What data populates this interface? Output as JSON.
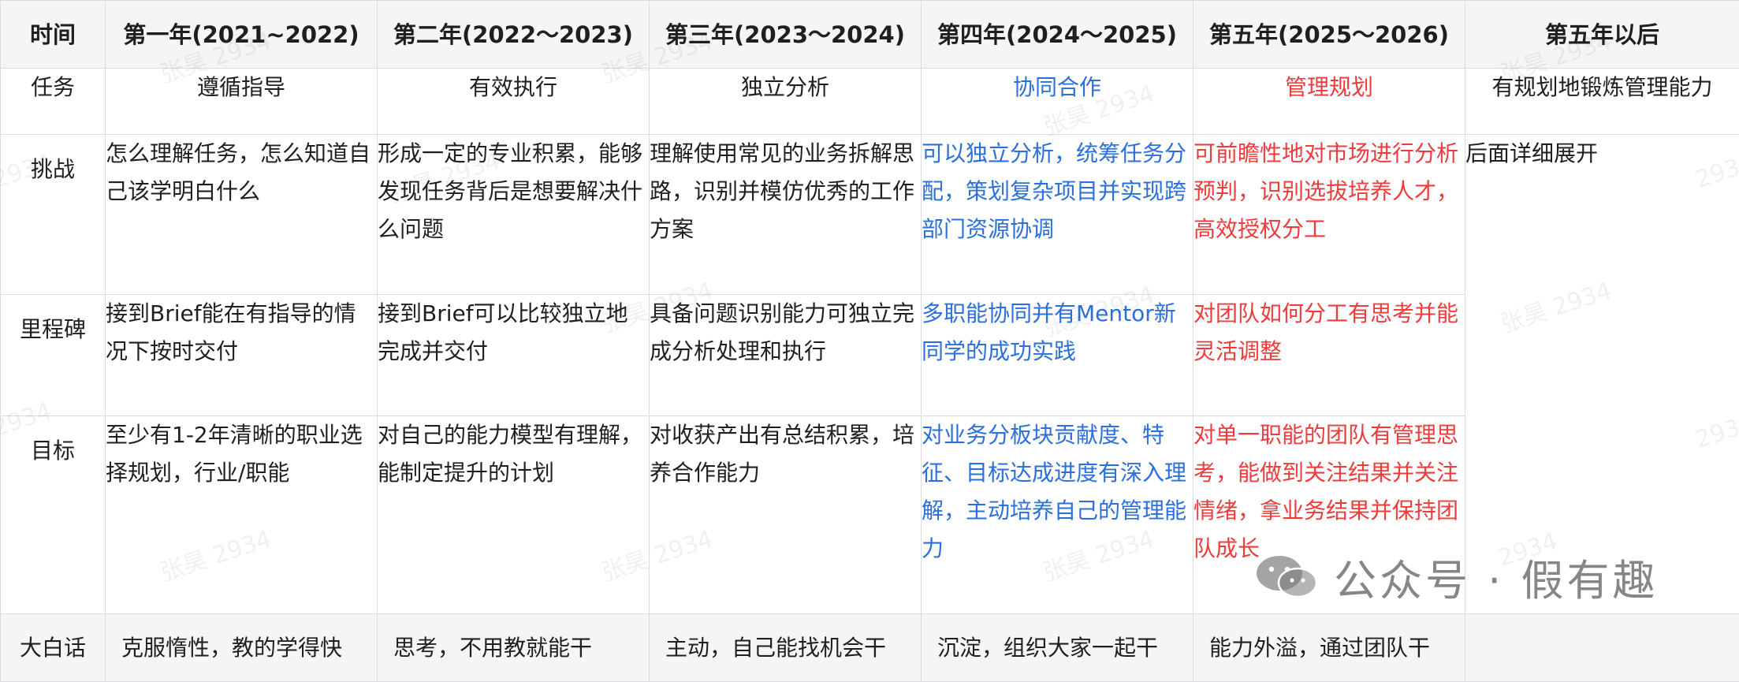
{
  "headers": [
    "时间",
    "第一年(2021~2022)",
    "第二年(2022～2023)",
    "第三年(2023～2024)",
    "第四年(2024～2025)",
    "第五年(2025～2026)",
    "第五年以后"
  ],
  "rows": {
    "task": {
      "label": "任务",
      "cells": [
        "遵循指导",
        "有效执行",
        "独立分析",
        "协同合作",
        "管理规划",
        "有规划地锻炼管理能力"
      ]
    },
    "challenge": {
      "label": "挑战",
      "cells": [
        "怎么理解任务，怎么知道自己该学明白什么",
        "形成一定的专业积累，能够发现任务背后是想要解决什么问题",
        "理解使用常见的业务拆解思路，识别并模仿优秀的工作方案",
        "可以独立分析，统筹任务分配，策划复杂项目并实现跨部门资源协调",
        "可前瞻性地对市场进行分析预判，识别选拔培养人才，高效授权分工",
        "后面详细展开"
      ]
    },
    "milestone": {
      "label": "里程碑",
      "cells": [
        "接到Brief能在有指导的情况下按时交付",
        "接到Brief可以比较独立地完成并交付",
        "具备问题识别能力可独立完成分析处理和执行",
        "多职能协同并有Mentor新同学的成功实践",
        "对团队如何分工有思考并能灵活调整"
      ]
    },
    "goal": {
      "label": "目标",
      "cells": [
        "至少有1-2年清晰的职业选择规划，行业/职能",
        "对自己的能力模型有理解，能制定提升的计划",
        "对收获产出有总结积累，培养合作能力",
        "对业务分板块贡献度、特征、目标达成进度有深入理解，主动培养自己的管理能力",
        "对单一职能的团队有管理思考，能做到关注结果并关注情绪，拿业务结果并保持团队成长"
      ]
    },
    "plain": {
      "label": "大白话",
      "cells": [
        "克服惰性，教的学得快",
        "思考，不用教就能干",
        "主动，自己能找机会干",
        "沉淀，组织大家一起干",
        "能力外溢，通过团队干",
        ""
      ]
    }
  },
  "watermark": {
    "texts": [
      "张昊 2934",
      "张昊 2934",
      "2934",
      "张昊 2934",
      "2934",
      "张昊 2934",
      "张昊 2934",
      "张昊 2934",
      "2934",
      "张昊 2934",
      "张昊 2934",
      "张昊 2934",
      "2934",
      "张昊 2934",
      "张昊 2934",
      "2934"
    ]
  },
  "brand": {
    "icon": "wechat-icon",
    "text": "公众号 · 假有趣"
  },
  "colors": {
    "header_bg": "#f4f5f7",
    "border": "#dadce0",
    "blue_text": "#2a6fdb",
    "red_text": "#ee3b3b"
  }
}
